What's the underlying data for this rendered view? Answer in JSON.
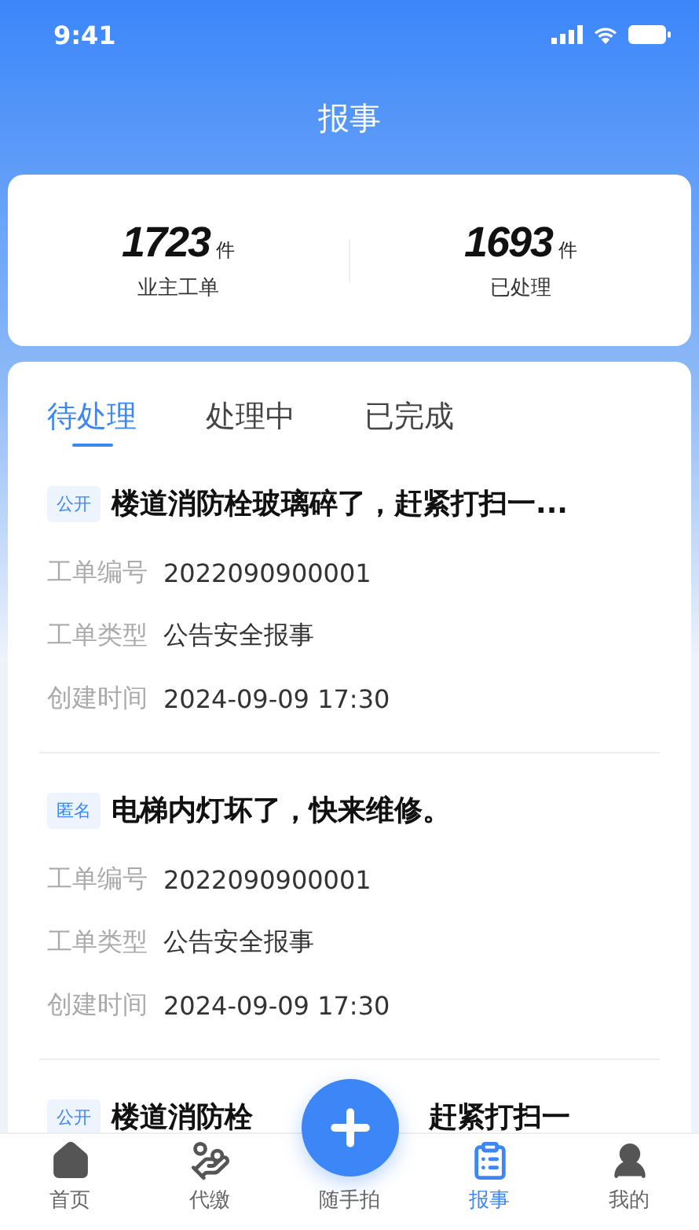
{
  "status_bar": {
    "time": "9:41"
  },
  "header": {
    "title": "报事"
  },
  "stats": [
    {
      "value": "1723",
      "unit": "件",
      "label": "业主工单"
    },
    {
      "value": "1693",
      "unit": "件",
      "label": "已处理"
    }
  ],
  "tabs": [
    {
      "label": "待处理",
      "selected": true
    },
    {
      "label": "处理中",
      "selected": false
    },
    {
      "label": "已完成",
      "selected": false
    }
  ],
  "orders": [
    {
      "tag": "公开",
      "title": "楼道消防栓玻璃碎了，赶紧打扫一...",
      "fields": [
        {
          "label": "工单编号",
          "value": "2022090900001"
        },
        {
          "label": "工单类型",
          "value": "公告安全报事"
        },
        {
          "label": "创建时间",
          "value": "2024-09-09 17:30"
        }
      ]
    },
    {
      "tag": "匿名",
      "title": "电梯内灯坏了，快来维修。",
      "fields": [
        {
          "label": "工单编号",
          "value": "2022090900001"
        },
        {
          "label": "工单类型",
          "value": "公告安全报事"
        },
        {
          "label": "创建时间",
          "value": "2024-09-09 17:30"
        }
      ]
    },
    {
      "tag": "公开",
      "title_parts": [
        "楼道消防栓",
        "赶紧打扫一"
      ]
    }
  ],
  "tab_bar": [
    {
      "kind": "home",
      "label": "首页",
      "selected": false
    },
    {
      "kind": "pay",
      "label": "代缴",
      "selected": false
    },
    {
      "kind": "fab",
      "label": "随手拍",
      "selected": false
    },
    {
      "kind": "report",
      "label": "报事",
      "selected": true
    },
    {
      "kind": "me",
      "label": "我的",
      "selected": false
    }
  ]
}
